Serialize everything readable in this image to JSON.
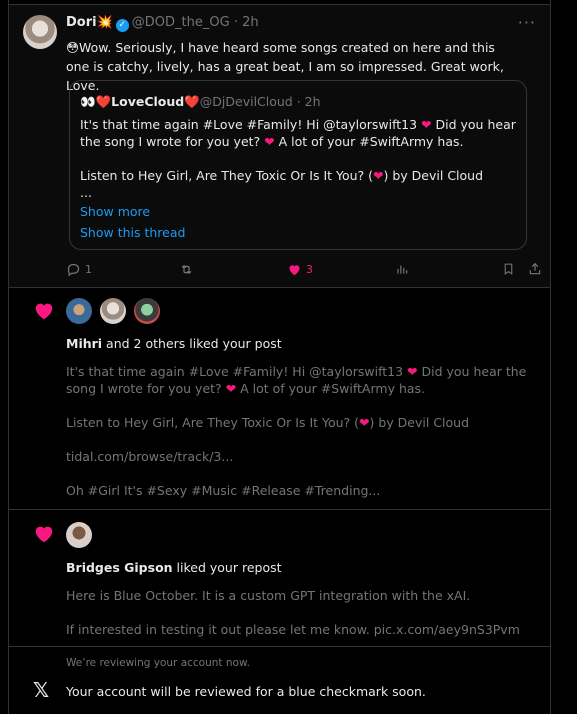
{
  "post": {
    "author_name": "Dori",
    "author_emoji": "💥",
    "handle": "@DOD_the_OG",
    "time": "2h",
    "text": "😳Wow. Seriously, I have heard some songs created on here and this one is catchy, lively, has a great beat, I am so impressed. Great work, Love.",
    "quote": {
      "name_prefix": "👀",
      "name": "❤️LoveCloud❤️",
      "handle": "@DjDevilCloud",
      "time": "2h",
      "line1_a": "It's that time again #Love #Family! Hi @taylorswift13 ",
      "line1_b": " Did you hear the song I wrote for you yet? ",
      "line1_c": " A lot of your #SwiftArmy has.",
      "line2_a": "Listen to Hey Girl, Are They Toxic Or Is It You? (",
      "line2_b": ") by Devil Cloud",
      "line3": "...",
      "show_more": "Show more",
      "show_thread": "Show this thread"
    },
    "actions": {
      "replies": "1",
      "reposts": "",
      "likes": "3"
    }
  },
  "notifications": [
    {
      "actor": "Mihri",
      "rest": " and 2 others liked your post",
      "p1_a": "It's that time again #Love #Family! Hi @taylorswift13 ",
      "p1_b": " Did you hear the song I wrote for you yet? ",
      "p1_c": " A lot of your #SwiftArmy has.",
      "p2_a": "Listen to Hey Girl, Are They Toxic Or Is It You? (",
      "p2_b": ") by Devil Cloud",
      "p3": "tidal.com/browse/track/3...",
      "p4": "Oh #Girl It's #Sexy #Music #Release #Trending..."
    },
    {
      "actor": "Bridges Gipson",
      "rest": " liked your repost",
      "p1": "Here is Blue October. It is a custom GPT integration with the xAI.",
      "p2": "If interested in testing it out please let me know. pic.x.com/aey9nS3Pvm"
    },
    {
      "small": "We’re reviewing your account now.",
      "main": "Your account will be reviewed for a blue checkmark soon."
    }
  ],
  "colors": {
    "like": "#f91880",
    "link": "#1d9bf0",
    "muted": "#71767b",
    "border": "#2f3336"
  }
}
